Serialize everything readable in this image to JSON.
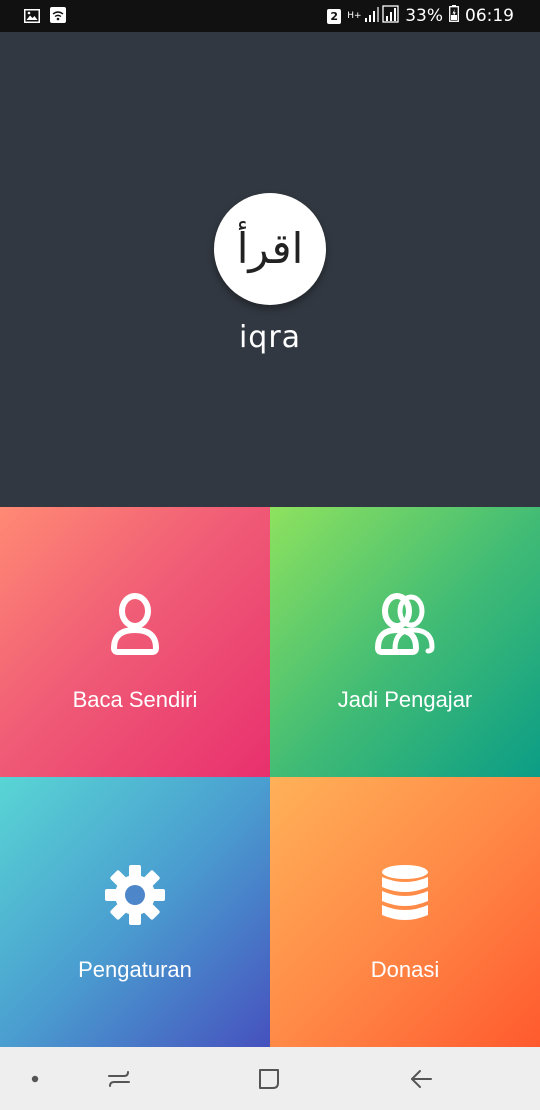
{
  "status_bar": {
    "sim_slot": "2",
    "network_type": "H+",
    "battery_percent": "33%",
    "time": "06:19",
    "icons": [
      "gallery-icon",
      "wifi-icon",
      "signal-icon",
      "battery-icon"
    ]
  },
  "header": {
    "logo_arabic": "اقرأ",
    "app_name": "iqra"
  },
  "menu": [
    {
      "label": "Baca Sendiri",
      "icon": "person-icon",
      "gradient": [
        "#ff8a74",
        "#e8306e"
      ]
    },
    {
      "label": "Jadi Pengajar",
      "icon": "people-icon",
      "gradient": [
        "#8ee25e",
        "#0b9d86"
      ]
    },
    {
      "label": "Pengaturan",
      "icon": "gear-icon",
      "gradient": [
        "#59d5d4",
        "#4651be"
      ]
    },
    {
      "label": "Donasi",
      "icon": "database-icon",
      "gradient": [
        "#ffb158",
        "#ff5a2e"
      ]
    }
  ],
  "nav_bar": {
    "icons": [
      "dot-icon",
      "recent-apps-icon",
      "home-icon",
      "back-icon"
    ]
  },
  "colors": {
    "header_bg": "#323841",
    "status_bar_bg": "#111111",
    "nav_bar_bg": "#eeeeee"
  }
}
